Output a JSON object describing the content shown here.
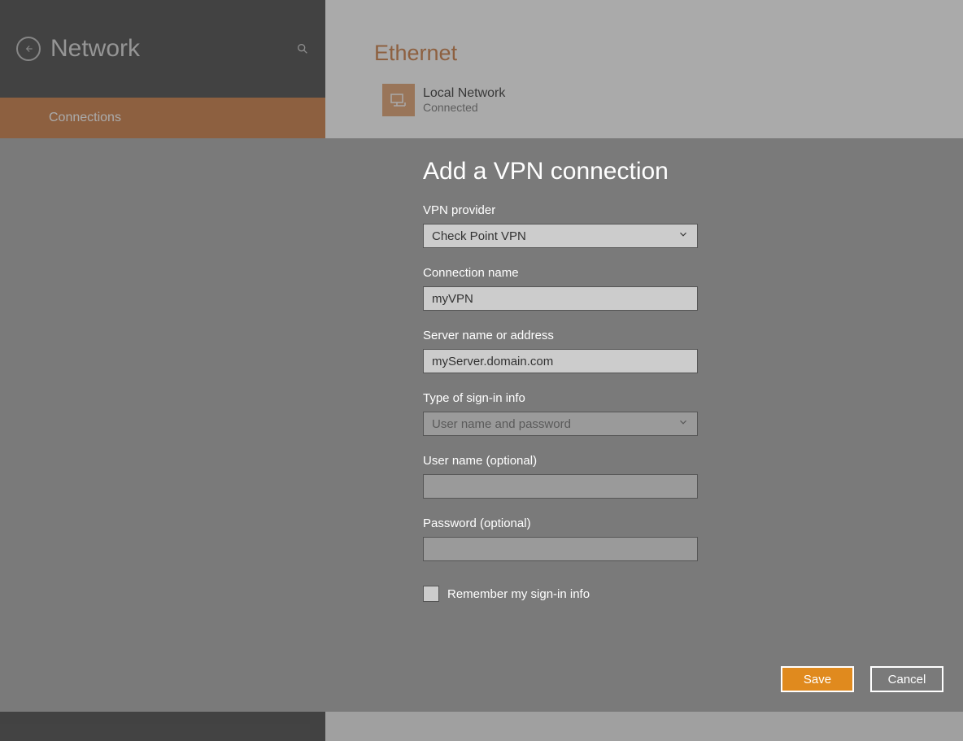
{
  "sidebar": {
    "title": "Network",
    "items": [
      {
        "label": "Connections"
      }
    ]
  },
  "main": {
    "section_title": "Ethernet",
    "connection": {
      "name": "Local Network",
      "status": "Connected"
    }
  },
  "modal": {
    "title": "Add a VPN connection",
    "fields": {
      "provider": {
        "label": "VPN provider",
        "value": "Check Point VPN"
      },
      "connection_name": {
        "label": "Connection name",
        "value": "myVPN"
      },
      "server": {
        "label": "Server name or address",
        "value": "myServer.domain.com"
      },
      "signin_type": {
        "label": "Type of sign-in info",
        "value": "User name and password"
      },
      "username": {
        "label": "User name (optional)",
        "value": ""
      },
      "password": {
        "label": "Password (optional)",
        "value": ""
      }
    },
    "remember": {
      "label": "Remember my sign-in info",
      "checked": false
    },
    "buttons": {
      "save": "Save",
      "cancel": "Cancel"
    }
  }
}
